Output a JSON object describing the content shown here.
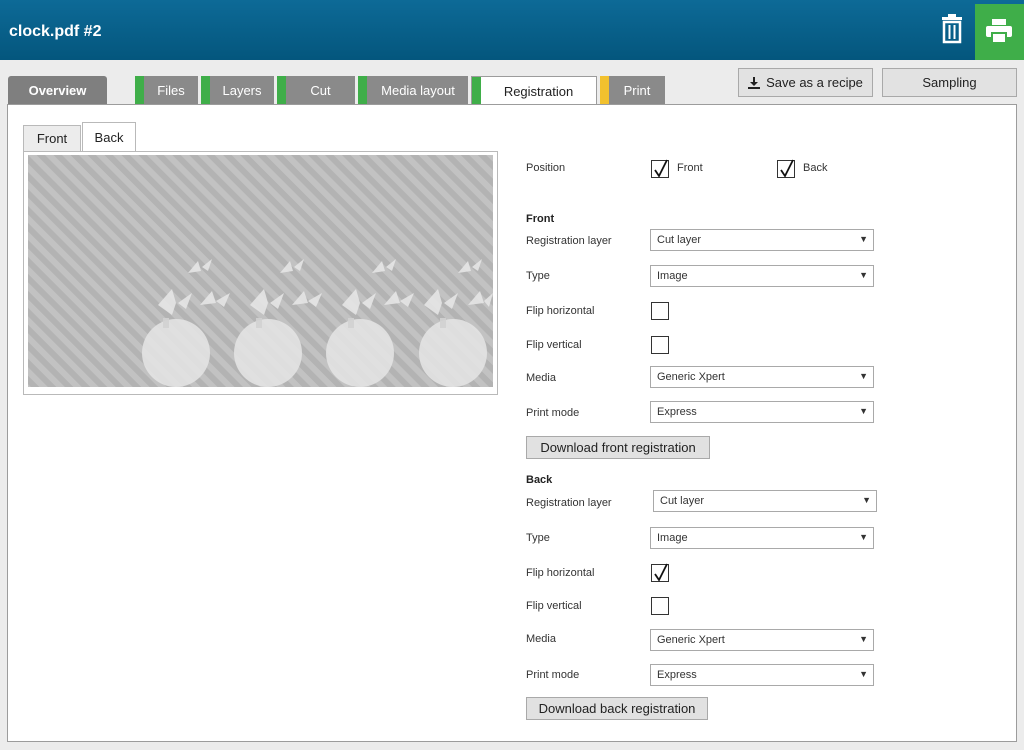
{
  "app": {
    "title": "clock.pdf #2"
  },
  "header": {
    "delete_icon": "trash-icon",
    "print_icon": "printer-icon"
  },
  "tabs": [
    {
      "label": "Overview",
      "status": "none"
    },
    {
      "label": "Files",
      "status": "#3fae49"
    },
    {
      "label": "Layers",
      "status": "#3fae49"
    },
    {
      "label": "Cut",
      "status": "#3fae49"
    },
    {
      "label": "Media layout",
      "status": "#3fae49"
    },
    {
      "label": "Registration",
      "status": "#3fae49",
      "active": true
    },
    {
      "label": "Print",
      "status": "#f2c12e"
    }
  ],
  "actions": {
    "save_recipe": "Save as a recipe",
    "sampling": "Sampling"
  },
  "subtabs": {
    "front": "Front",
    "back": "Back",
    "selected": "Back"
  },
  "form": {
    "position": {
      "label": "Position",
      "front_label": "Front",
      "front_checked": true,
      "back_label": "Back",
      "back_checked": true
    },
    "front": {
      "heading": "Front",
      "registration_layer": {
        "label": "Registration layer",
        "value": "Cut layer"
      },
      "type": {
        "label": "Type",
        "value": "Image"
      },
      "flip_horizontal": {
        "label": "Flip horizontal",
        "checked": false
      },
      "flip_vertical": {
        "label": "Flip vertical",
        "checked": false
      },
      "media": {
        "label": "Media",
        "value": "Generic Xpert"
      },
      "print_mode": {
        "label": "Print mode",
        "value": "Express"
      },
      "download": "Download front registration"
    },
    "back": {
      "heading": "Back",
      "registration_layer": {
        "label": "Registration layer",
        "value": "Cut layer"
      },
      "type": {
        "label": "Type",
        "value": "Image"
      },
      "flip_horizontal": {
        "label": "Flip horizontal",
        "checked": true
      },
      "flip_vertical": {
        "label": "Flip vertical",
        "checked": false
      },
      "media": {
        "label": "Media",
        "value": "Generic Xpert"
      },
      "print_mode": {
        "label": "Print mode",
        "value": "Express"
      },
      "download": "Download back registration"
    }
  },
  "colors": {
    "header": "#04567d",
    "ok": "#3fae49",
    "warn": "#f2c12e"
  }
}
